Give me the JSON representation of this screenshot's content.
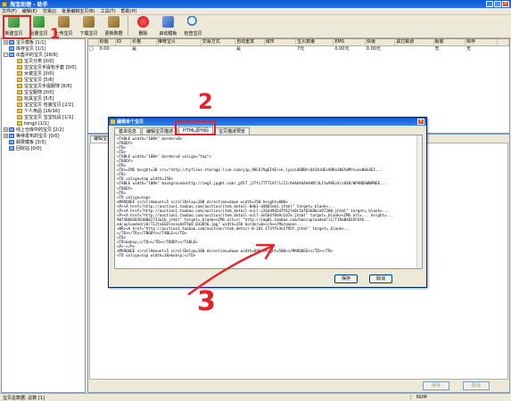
{
  "window": {
    "title": "淘宝助理 - 助手"
  },
  "menu": [
    "文件(F)",
    "编辑(E)",
    "交易(J)",
    "批量编辑宝贝(B)",
    "工具(T)",
    "帮助(H)"
  ],
  "toolbar": {
    "buttons": [
      {
        "label": "新建宝贝",
        "icon": "new-item-icon",
        "color": "green"
      },
      {
        "label": "批量宝贝",
        "icon": "batch-item-icon",
        "color": "green"
      },
      {
        "label": "上传宝贝",
        "icon": "upload-icon",
        "color": "brown"
      },
      {
        "label": "下载宝贝",
        "icon": "download-icon",
        "color": "brown"
      },
      {
        "label": "更新数据",
        "icon": "update-data-icon",
        "color": "brown"
      },
      {
        "label": "删除",
        "icon": "delete-icon",
        "color": "red"
      },
      {
        "label": "启动模板",
        "icon": "template-icon",
        "color": "blue"
      },
      {
        "label": "检查宝贝",
        "icon": "check-icon",
        "color": "search"
      }
    ]
  },
  "tree": {
    "items": [
      {
        "label": "宝贝模板 [1/1]",
        "indent": 0,
        "toggle": "+"
      },
      {
        "label": "库存宝贝 [1/1]",
        "indent": 0,
        "toggle": ""
      },
      {
        "label": "出售中的宝贝 [28/8]",
        "indent": 0,
        "toggle": "-"
      },
      {
        "label": "宝贝分类 [0/0]",
        "indent": 1,
        "toggle": ""
      },
      {
        "label": "宝宝宝贝手提包手套 [0/0]",
        "indent": 1,
        "toggle": ""
      },
      {
        "label": "女装宝贝 [0/0]",
        "indent": 1,
        "toggle": ""
      },
      {
        "label": "宝宝宝贝 [5/6]",
        "indent": 1,
        "toggle": ""
      },
      {
        "label": "宝宝宝贝手提服饰 [6/6]",
        "indent": 1,
        "toggle": ""
      },
      {
        "label": "宝宝服饰 [0/0]",
        "indent": 1,
        "toggle": ""
      },
      {
        "label": "玩具宝贝 [5/5]",
        "indent": 1,
        "toggle": ""
      },
      {
        "label": "宝宝宝贝 包装宝贝 [2/2]",
        "indent": 1,
        "toggle": ""
      },
      {
        "label": "个人用品 [16/16]",
        "indent": 1,
        "toggle": ""
      },
      {
        "label": "宝宝宝贝 宝宝玩具 [1/1]",
        "indent": 1,
        "toggle": ""
      },
      {
        "label": "tongji [1/1]",
        "indent": 1,
        "toggle": ""
      },
      {
        "label": "线上仓库中的宝贝 [2/2]",
        "indent": 0,
        "toggle": "+"
      },
      {
        "label": "等待发布的宝贝 [0/0]",
        "indent": 0,
        "toggle": "+"
      },
      {
        "label": "邮费模板 [3/3]",
        "indent": 0,
        "toggle": ""
      },
      {
        "label": "回收站 [0/0]",
        "indent": 0,
        "toggle": ""
      }
    ]
  },
  "grid": {
    "headers": [
      "",
      "标题",
      "ID",
      "价格",
      "推荐宝贝",
      "交易方式",
      "自动重发",
      "城市",
      "宝贝数量",
      "EMS",
      "快递",
      "其它邮费",
      "橱窗",
      "库存",
      ""
    ],
    "rows": [
      [
        "□",
        "0.00",
        "",
        "是",
        "",
        "",
        "是",
        "",
        "7元",
        "0.00元",
        "0.00元",
        "",
        "无",
        "无",
        ""
      ]
    ]
  },
  "bottom_panel": {
    "tab": "编辑宝贝",
    "buttons": [
      "保存",
      "取消"
    ]
  },
  "dialog": {
    "title": "编辑单个宝贝",
    "tabs": [
      "基本信息",
      "编辑宝贝描述",
      "HTML源代码",
      "宝贝描述预览"
    ],
    "active_tab": 2,
    "code_lines": [
      "<TABLE width=\"100%\" border=0>",
      "<TBODY>",
      "<TR>",
      "<TD>",
      "<TABLE width=\"100%\" border=0 valign=\"top\">",
      "<TBODY>",
      "<TR>",
      "<TD><IMG height=30 src=\"http://hyfiles.storage.live.com/y1p_9KCA7VgEIVEr+e_lyxcz4DDBt+QX1AiHEc9ORnJWS5dMYvuseB6kAEI...",
      "<TR>",
      "<TD valign=top width=150>",
      "<TABLE width=\"100%\" background=http://img1.jpgbt.com/_gfE7_jJTtc7TTT1A7/1/21/AAAAAAAAAAM/3L1tw9VEzX/s640/WPANDEWWPNEE...",
      "<TBODY>",
      "<TR>",
      "<TD valign=top>",
      "<MARQUEE scrollAmount=5 scrollDelay=100 direction=down width=150 height=800>",
      "<P><A href=\"http://auction1.taobao.com/auction/item_detail-0db1-d4865eb1.jhtml\" target=_blank>...",
      "<P><A href=\"http://auction1.taobao.com/auction/item_detail-null-c264d9424ff62fe0c1bf83b0bca97280.jhtml\" target=_blank>...",
      "<P><A href=\"http://auction1.taobao.com/auction/item_detail-null-3e5b4f8a9c1d7e.jhtml\" target=_blank><IMG alt=... height=...",
      "9074060383010882733a1b.jhtml\" target=_blank><IMG alt=<\\ \"http://img01.taobao.com/bao/uploaded/i1/T1RaBXEEVFXXX...",
      "ed/uploaded/i8/T1JtxEEDlnsnxXdT9p8_033856.jpg\" width=150 border=0></A></Marquee>...",
      "<BR><A href=\"http://auction1.taobao.com/auction/item_detail-0-2d1-173ffe3e1f95f.jhtml\" target=_blank>...",
      "</TD></TR></TBODY></TABLE></TD>",
      "<TD>",
      "<TD>&nbsp;</TD></TR></TBODY></TABLE>",
      "<P>-</P>",
      "<MARQUEE scrollAmount=5 scrollDelay=100 direction=down width=600 height=500></MARQUEE></TD></TR>",
      "<TD valign=top width=10>&nbsp;</TD>"
    ],
    "buttons": [
      "保存",
      "取消"
    ]
  },
  "statusbar": {
    "left": "宝贝总数据: 总数 [1]",
    "right": "NUM"
  },
  "annotations": {
    "n1": "1",
    "n2": "2",
    "n3": "3",
    "color": "#e8202a"
  }
}
